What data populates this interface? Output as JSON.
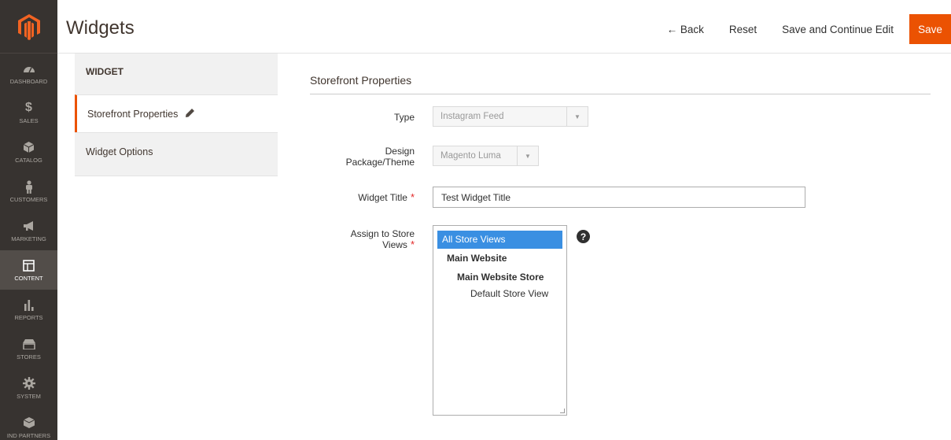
{
  "nav": {
    "items": [
      {
        "label": "DASHBOARD",
        "icon": "dashboard-icon"
      },
      {
        "label": "SALES",
        "icon": "dollar-icon"
      },
      {
        "label": "CATALOG",
        "icon": "cube-icon"
      },
      {
        "label": "CUSTOMERS",
        "icon": "person-icon"
      },
      {
        "label": "MARKETING",
        "icon": "megaphone-icon"
      },
      {
        "label": "CONTENT",
        "icon": "layout-icon"
      },
      {
        "label": "REPORTS",
        "icon": "bar-chart-icon"
      },
      {
        "label": "STORES",
        "icon": "store-icon"
      },
      {
        "label": "SYSTEM",
        "icon": "gear-icon"
      },
      {
        "label": "IND PARTNERS",
        "icon": "box-icon"
      }
    ],
    "active": "CONTENT"
  },
  "header": {
    "title": "Widgets",
    "back_label": "← Back",
    "reset_label": "Reset",
    "save_continue_label": "Save and Continue Edit",
    "save_label": "Save",
    "accent": "#eb5202"
  },
  "tabs": {
    "heading": "WIDGET",
    "items": [
      {
        "label": "Storefront Properties",
        "active": true
      },
      {
        "label": "Widget Options",
        "active": false
      }
    ]
  },
  "form": {
    "section_title": "Storefront Properties",
    "type_label": "Type",
    "type_value": "Instagram Feed",
    "theme_label_1": "Design",
    "theme_label_2": "Package/Theme",
    "theme_value": "Magento Luma",
    "title_label": "Widget Title",
    "title_value": "Test Widget Title",
    "store_label_1": "Assign to Store",
    "store_label_2": "Views",
    "required_mark": "*",
    "store_options": [
      {
        "label": "All Store Views",
        "selected": true
      },
      {
        "label": "Main Website"
      },
      {
        "label": "Main Website Store"
      },
      {
        "label": "Default Store View"
      }
    ],
    "help_glyph": "?"
  }
}
